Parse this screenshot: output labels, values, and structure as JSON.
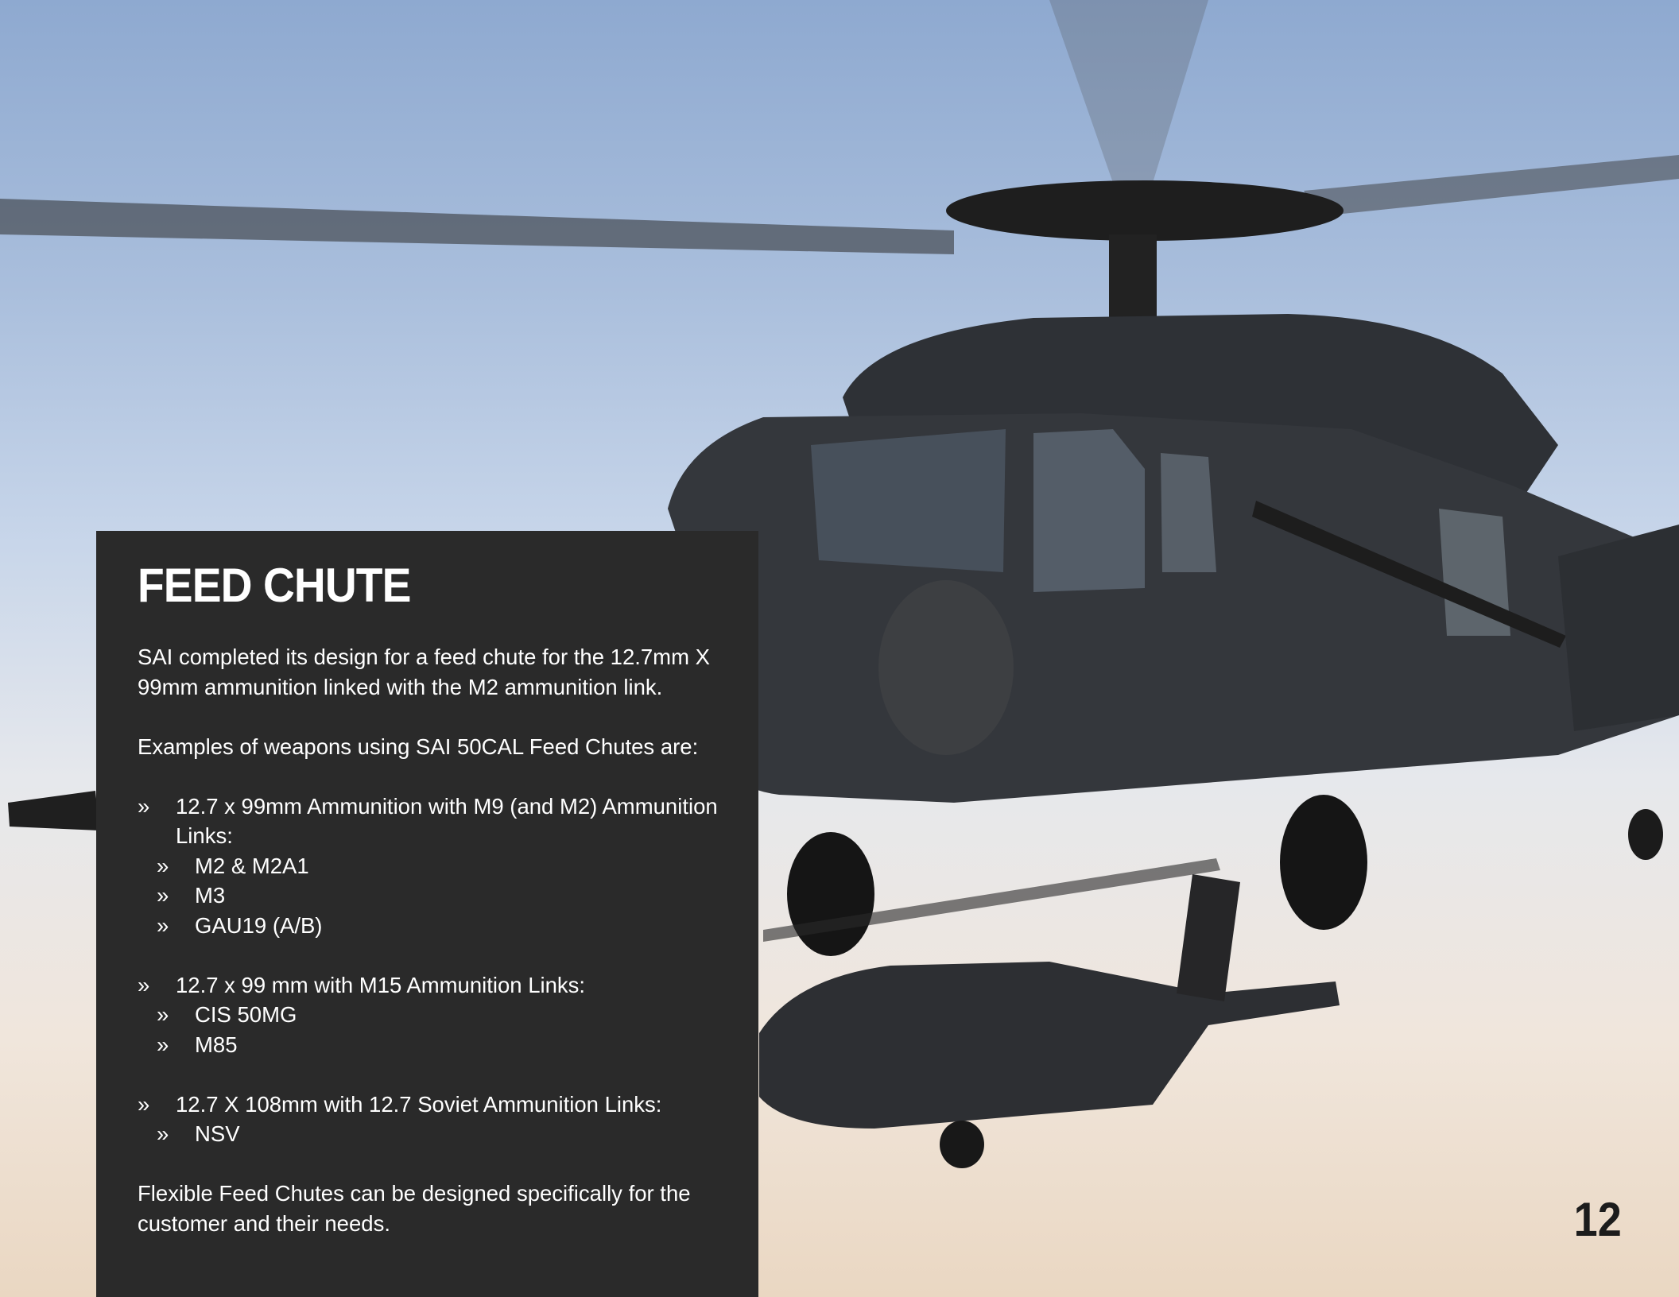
{
  "section": {
    "title": "FEED CHUTE",
    "intro": "SAI completed its design for a feed chute for the 12.7mm X 99mm ammunition linked with the M2 ammunition link.",
    "examples_heading": "Examples of weapons using SAI 50CAL Feed Chutes are:",
    "groups": [
      {
        "label": "12.7 x 99mm Ammunition with M9 (and M2) Ammunition Links:",
        "items": [
          "M2 & M2A1",
          "M3",
          "GAU19 (A/B)"
        ]
      },
      {
        "label": "12.7 x 99 mm with M15 Ammunition Links:",
        "items": [
          "CIS 50MG",
          "M85"
        ]
      },
      {
        "label": "12.7 X 108mm with 12.7 Soviet Ammunition Links:",
        "items": [
          "NSV"
        ]
      }
    ],
    "closing": "Flexible Feed Chutes can be designed specifically for the customer and their needs."
  },
  "bullet_marker": "»",
  "page_number": "12"
}
